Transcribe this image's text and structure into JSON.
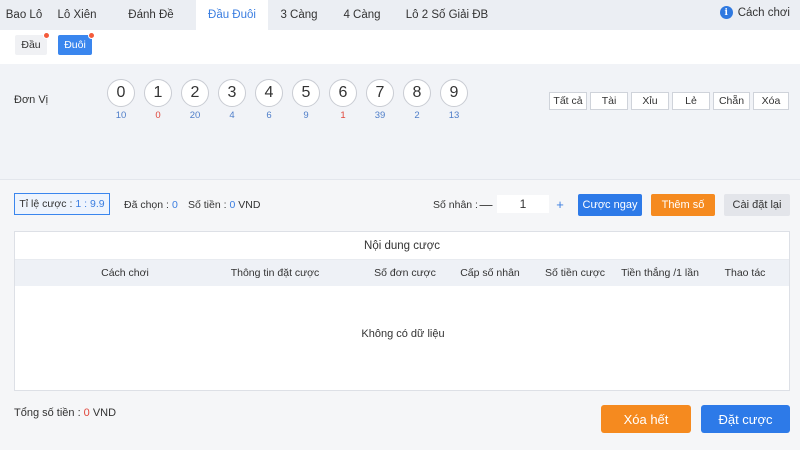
{
  "tabs": [
    "Bao Lô",
    "Lô Xiên",
    "Đánh Đề",
    "Đầu Đuôi",
    "3 Càng",
    "4 Càng",
    "Lô 2 Số Giải ĐB"
  ],
  "active_tab": 3,
  "help": {
    "icon": "info-icon",
    "label": "Cách chơi"
  },
  "subtabs": {
    "dau": "Đầu",
    "duoi": "Đuôi",
    "active": "Đuôi"
  },
  "picker": {
    "row_label": "Đơn Vị",
    "balls": [
      {
        "num": "0",
        "count": "10"
      },
      {
        "num": "1",
        "count": "0"
      },
      {
        "num": "2",
        "count": "20"
      },
      {
        "num": "3",
        "count": "4"
      },
      {
        "num": "4",
        "count": "6"
      },
      {
        "num": "5",
        "count": "9"
      },
      {
        "num": "6",
        "count": "1"
      },
      {
        "num": "7",
        "count": "39"
      },
      {
        "num": "8",
        "count": "2"
      },
      {
        "num": "9",
        "count": "13"
      }
    ],
    "quick": [
      "Tất cả",
      "Tài",
      "Xỉu",
      "Lẻ",
      "Chẵn",
      "Xóa"
    ]
  },
  "bet": {
    "rate_label": "Tỉ lệ cược :",
    "rate_value": "1 : 9.9",
    "selected_label": "Đã chọn :",
    "selected_value": "0",
    "amount_label": "Số tiền :",
    "amount_value": "0",
    "amount_unit": "VND",
    "multiplier_label": "Số nhân :",
    "multiplier_value": "1",
    "minus": "—",
    "plus": "+",
    "bet_now": "Cược ngay",
    "add_number": "Thêm số",
    "reset": "Cài đặt lại"
  },
  "table": {
    "title": "Nội dung cược",
    "columns": [
      "Cách chơi",
      "Thông tin đặt cược",
      "Số đơn cược",
      "Cấp số nhân",
      "Số tiền cược",
      "Tiền thắng /1 lần",
      "Thao tác"
    ],
    "empty": "Không có dữ liệu"
  },
  "footer": {
    "total_label": "Tổng số tiền :",
    "total_value": "0",
    "total_unit": "VND",
    "clear_all": "Xóa hết",
    "place_bet": "Đặt cược"
  },
  "colors": {
    "accent": "#2d7ae8",
    "orange": "#f58a1f",
    "red": "#e0453a"
  }
}
